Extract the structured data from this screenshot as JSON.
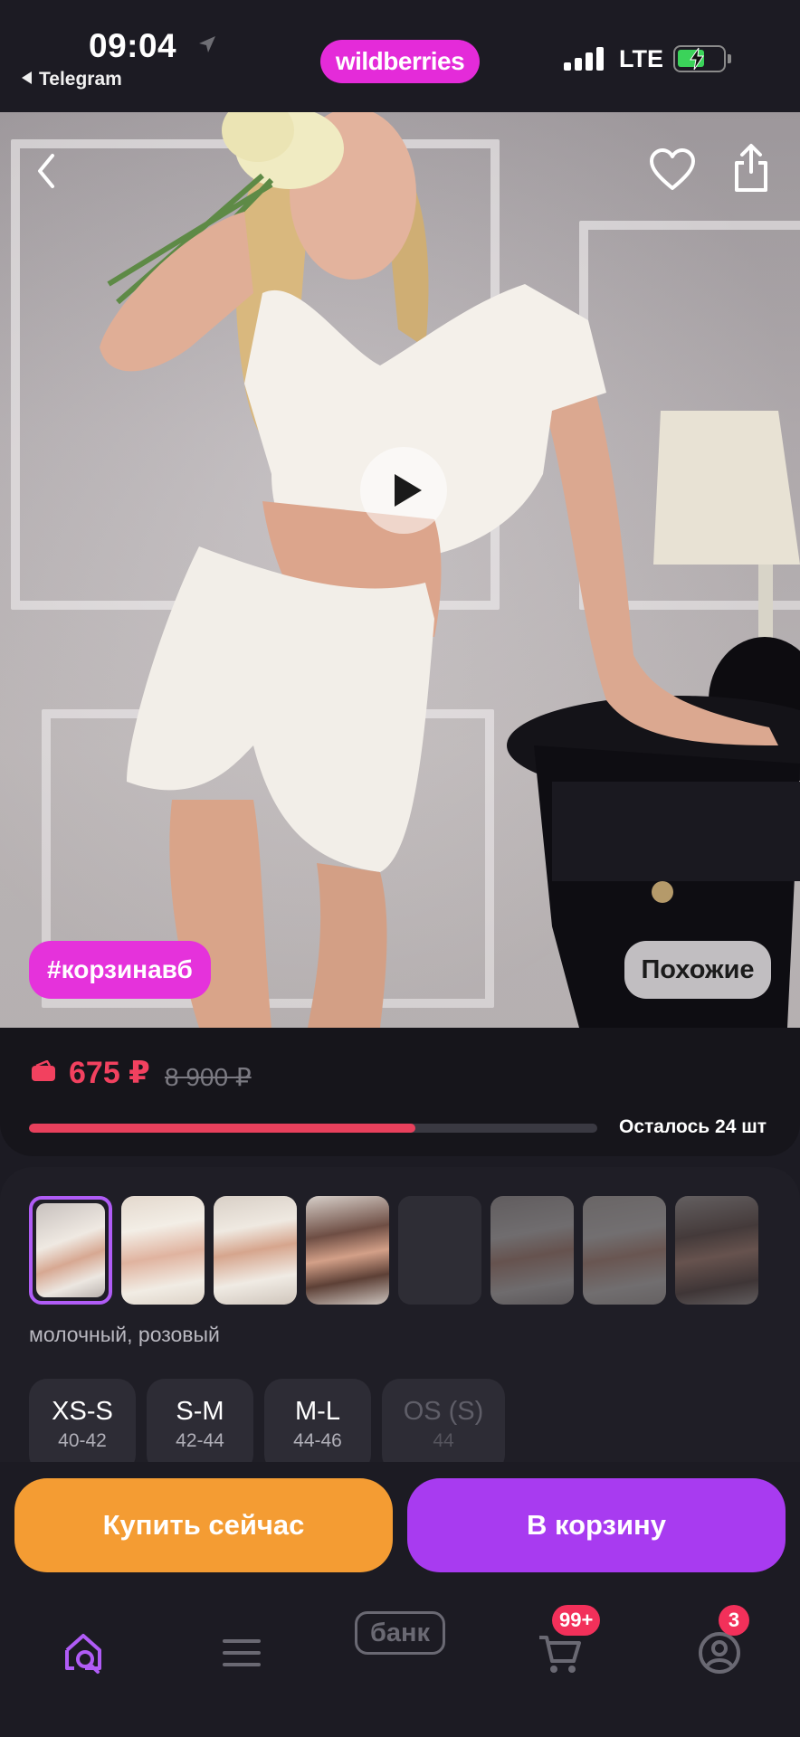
{
  "status_bar": {
    "time": "09:04",
    "back_app": "Telegram",
    "network": "LTE",
    "battery_level": 0.6
  },
  "brand": {
    "logo_text": "wildberries",
    "color": "#e42bd9"
  },
  "product_media": {
    "tag": "#корзинавб",
    "similar_label": "Похожие"
  },
  "pricing": {
    "price": "675 ₽",
    "old_price": "8 900 ₽",
    "price_color": "#f2415f",
    "stock_progress": 0.68,
    "remaining_text": "Осталось 24 шт"
  },
  "variants": {
    "color_name": "молочный, розовый",
    "thumbnails": [
      {
        "name": "variant-1",
        "selected": true
      },
      {
        "name": "variant-2",
        "selected": false
      },
      {
        "name": "variant-3",
        "selected": false
      },
      {
        "name": "variant-4",
        "selected": false
      },
      {
        "name": "variant-5",
        "selected": false
      },
      {
        "name": "variant-6",
        "selected": false
      },
      {
        "name": "variant-7",
        "selected": false
      },
      {
        "name": "variant-8",
        "selected": false
      }
    ],
    "sizes": [
      {
        "label": "XS-S",
        "ru": "40-42",
        "available": true
      },
      {
        "label": "S-M",
        "ru": "42-44",
        "available": true
      },
      {
        "label": "M-L",
        "ru": "44-46",
        "available": true
      },
      {
        "label": "OS (S)",
        "ru": "44",
        "available": false
      }
    ]
  },
  "actions": {
    "buy_now": "Купить сейчас",
    "add_to_cart": "В корзину"
  },
  "tabbar": {
    "bank_label": "банк",
    "cart_badge": "99+",
    "profile_badge": "3",
    "icons": [
      "home-search-icon",
      "menu-icon",
      "bank-icon",
      "cart-icon",
      "profile-icon"
    ]
  }
}
